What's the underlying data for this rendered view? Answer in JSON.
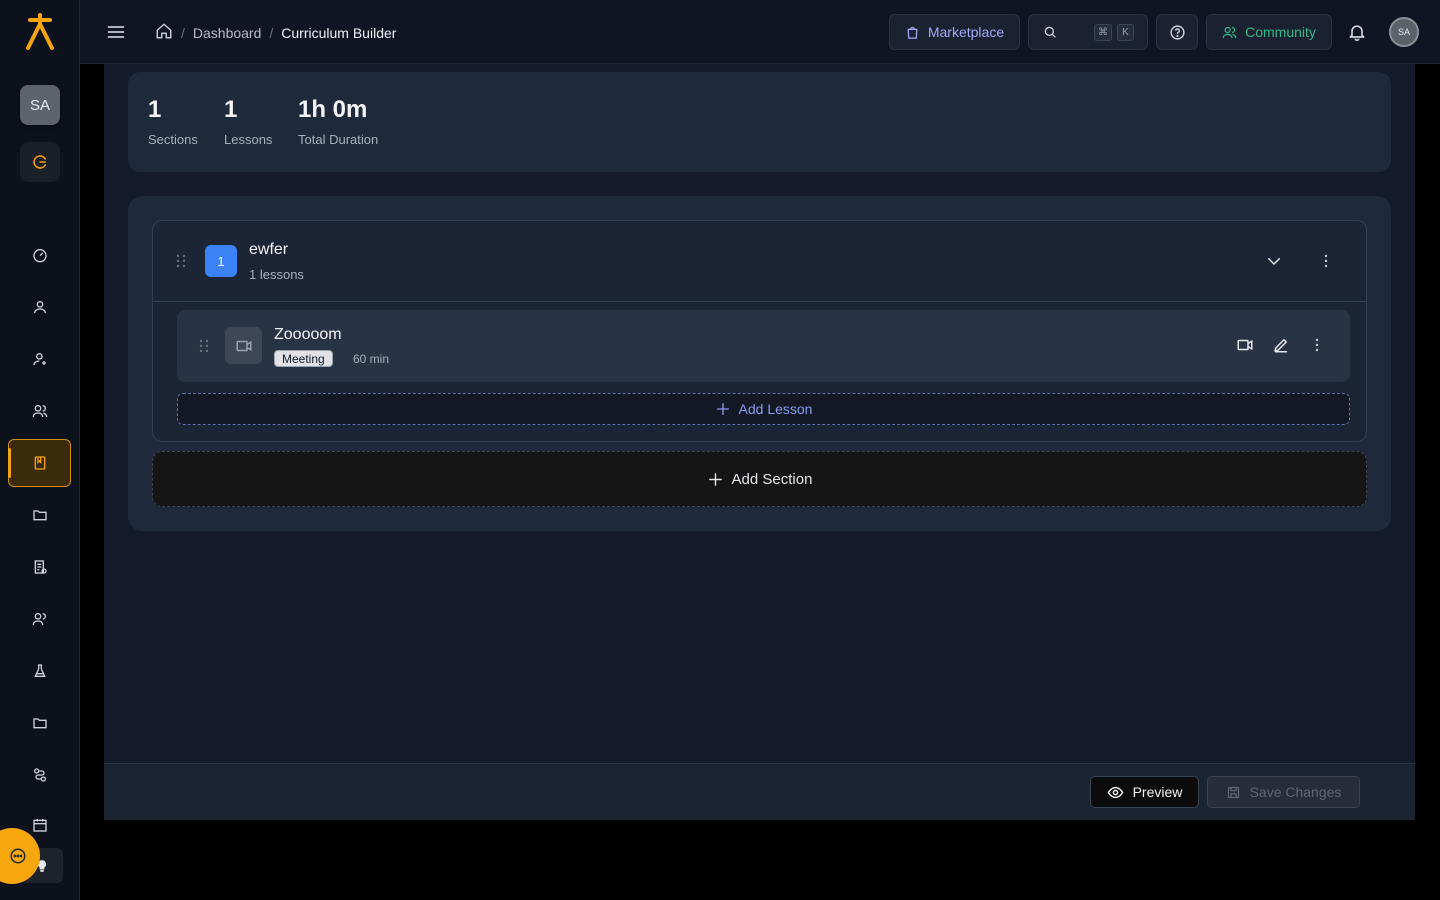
{
  "sidebar": {
    "avatar_initials": "SA",
    "nav_icons": [
      "dashboard-icon",
      "user-icon",
      "user-plus-icon",
      "users-icon",
      "book-icon",
      "folder-icon",
      "report-icon",
      "group-icon",
      "flask-icon",
      "folder-icon",
      "route-icon",
      "calendar-icon"
    ],
    "active_index": 4,
    "accent_color": "#f5a30f"
  },
  "header": {
    "breadcrumb": {
      "home_icon": "home-icon",
      "sep": "/",
      "dashboard": "Dashboard",
      "current": "Curriculum Builder"
    },
    "marketplace_label": "Marketplace",
    "search_shortcut_mod": "⌘",
    "search_shortcut_key": "K",
    "community_label": "Community",
    "avatar_initials": "SA"
  },
  "stats": {
    "sections_value": "1",
    "sections_label": "Sections",
    "lessons_value": "1",
    "lessons_label": "Lessons",
    "duration_value": "1h 0m",
    "duration_label": "Total Duration"
  },
  "section": {
    "number": "1",
    "title": "ewfer",
    "subtitle": "1 lessons",
    "number_color": "#3b82f6",
    "lesson": {
      "title": "Zooooom",
      "type_badge": "Meeting",
      "duration": "60 min"
    },
    "add_lesson_label": "Add Lesson"
  },
  "add_section_label": "Add Section",
  "footer": {
    "preview_label": "Preview",
    "save_label": "Save Changes"
  }
}
